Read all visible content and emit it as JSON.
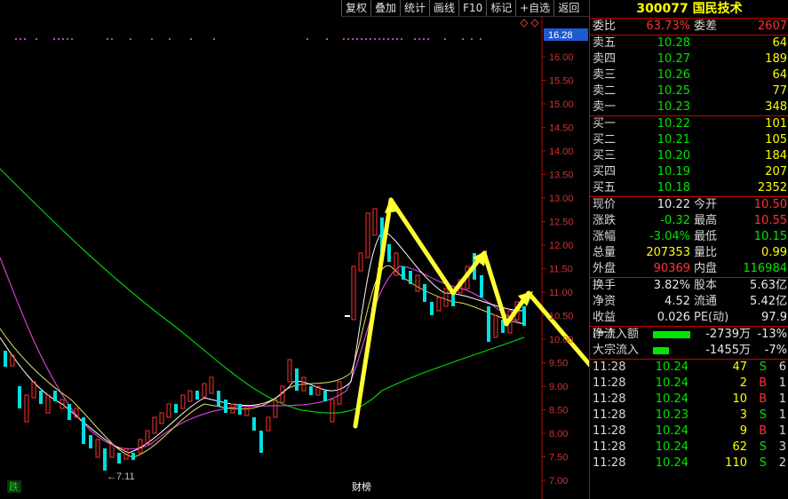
{
  "toolbar": {
    "items": [
      "复权",
      "叠加",
      "统计",
      "画线",
      "F10",
      "标记",
      "+自选",
      "返回"
    ]
  },
  "chart": {
    "price_box": "16.28",
    "y_ticks": [
      "16.00",
      "15.50",
      "15.00",
      "14.50",
      "14.00",
      "13.50",
      "13.00",
      "12.50",
      "12.00",
      "11.50",
      "11.00",
      "10.50",
      "10.00",
      "9.50",
      "9.00",
      "8.50",
      "8.00",
      "7.50",
      "7.00"
    ],
    "low_label": "←7.11",
    "tag_left": "跌",
    "tag_mid": "财榜"
  },
  "stock": {
    "code_name": "300077 国民技术"
  },
  "weibi": {
    "label": "委比",
    "value": "63.73%",
    "label2": "委差",
    "value2": "2607"
  },
  "sells": [
    {
      "label": "卖五",
      "price": "10.28",
      "vol": "64"
    },
    {
      "label": "卖四",
      "price": "10.27",
      "vol": "189"
    },
    {
      "label": "卖三",
      "price": "10.26",
      "vol": "64"
    },
    {
      "label": "卖二",
      "price": "10.25",
      "vol": "77"
    },
    {
      "label": "卖一",
      "price": "10.23",
      "vol": "348"
    }
  ],
  "buys": [
    {
      "label": "买一",
      "price": "10.22",
      "vol": "101"
    },
    {
      "label": "买二",
      "price": "10.21",
      "vol": "105"
    },
    {
      "label": "买三",
      "price": "10.20",
      "vol": "184"
    },
    {
      "label": "买四",
      "price": "10.19",
      "vol": "207"
    },
    {
      "label": "买五",
      "price": "10.18",
      "vol": "2352"
    }
  ],
  "quote": [
    {
      "l1": "现价",
      "v1": "10.22",
      "l2": "今开",
      "v2": "10.50"
    },
    {
      "l1": "涨跌",
      "v1": "-0.32",
      "l2": "最高",
      "v2": "10.55"
    },
    {
      "l1": "涨幅",
      "v1": "-3.04%",
      "l2": "最低",
      "v2": "10.15"
    },
    {
      "l1": "总量",
      "v1": "207353",
      "l2": "量比",
      "v2": "0.99"
    },
    {
      "l1": "外盘",
      "v1": "90369",
      "l2": "内盘",
      "v2": "116984"
    }
  ],
  "stats": [
    {
      "l1": "换手",
      "v1": "3.82%",
      "l2": "股本",
      "v2": "5.63亿"
    },
    {
      "l1": "净资",
      "v1": "4.52",
      "l2": "流通",
      "v2": "5.42亿"
    },
    {
      "l1": "收益(一)",
      "v1": "0.026",
      "l2": "PE(动)",
      "v2": "97.9"
    }
  ],
  "flows": [
    {
      "label": "净流入额",
      "value": "-2739万",
      "pct": "-13%"
    },
    {
      "label": "大宗流入",
      "value": "-1455万",
      "pct": "-7%"
    }
  ],
  "trades": [
    {
      "time": "11:28",
      "price": "10.24",
      "vol": "47",
      "side": "S",
      "n": "6"
    },
    {
      "time": "11:28",
      "price": "10.24",
      "vol": "2",
      "side": "B",
      "n": "1"
    },
    {
      "time": "11:28",
      "price": "10.24",
      "vol": "10",
      "side": "B",
      "n": "1"
    },
    {
      "time": "11:28",
      "price": "10.23",
      "vol": "3",
      "side": "S",
      "n": "1"
    },
    {
      "time": "11:28",
      "price": "10.24",
      "vol": "9",
      "side": "B",
      "n": "1"
    },
    {
      "time": "11:28",
      "price": "10.24",
      "vol": "62",
      "side": "S",
      "n": "3"
    },
    {
      "time": "11:28",
      "price": "10.24",
      "vol": "110",
      "side": "S",
      "n": "2"
    }
  ]
}
